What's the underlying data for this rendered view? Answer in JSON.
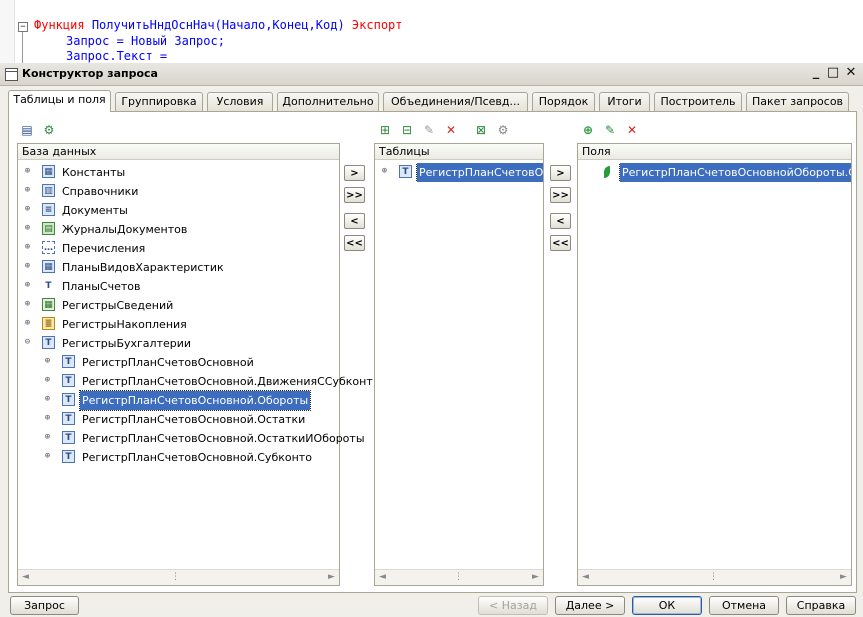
{
  "code": {
    "line1_kw": "Функция",
    "line1_name": "ПолучитьНндОснНач(Начало,Конец,Код)",
    "line1_export": "Экспорт",
    "line2": "Запрос = Новый Запрос;",
    "line3": "Запрос.Текст ="
  },
  "window": {
    "title": "Конструктор запроса"
  },
  "tabs": [
    "Таблицы и поля",
    "Группировка",
    "Условия",
    "Дополнительно",
    "Объединения/Псевд...",
    "Порядок",
    "Итоги",
    "Построитель",
    "Пакет запросов"
  ],
  "db_panel": {
    "header": "База данных",
    "items": [
      "Константы",
      "Справочники",
      "Документы",
      "ЖурналыДокументов",
      "Перечисления",
      "ПланыВидовХарактеристик",
      "ПланыСчетов",
      "РегистрыСведений",
      "РегистрыНакопления",
      "РегистрыБухгалтерии"
    ],
    "children": [
      "РегистрПланСчетовОсновной",
      "РегистрПланСчетовОсновной.ДвиженияССубконт",
      "РегистрПланСчетовОсновной.Обороты",
      "РегистрПланСчетовОсновной.Остатки",
      "РегистрПланСчетовОсновной.ОстаткиИОбороты",
      "РегистрПланСчетовОсновной.Субконто"
    ],
    "selected_index": 2
  },
  "tables_panel": {
    "header": "Таблицы",
    "items": [
      "РегистрПланСчетовОсновнойОбороты"
    ]
  },
  "fields_panel": {
    "header": "Поля",
    "items": [
      "РегистрПланСчетовОсновнойОбороты.СуммаОборотДт"
    ]
  },
  "move_buttons": [
    ">",
    ">>",
    "<",
    "<<"
  ],
  "footer": {
    "query": "Запрос",
    "back": "< Назад",
    "next": "Далее >",
    "ok": "ОК",
    "cancel": "Отмена",
    "help": "Справка"
  }
}
